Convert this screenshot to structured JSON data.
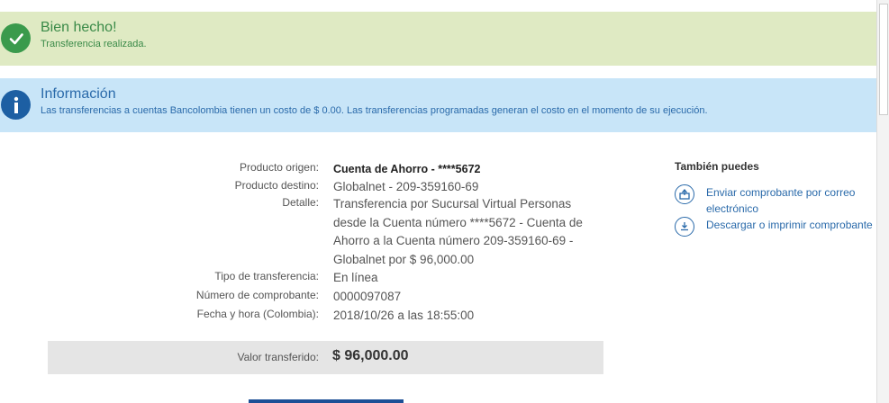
{
  "success_alert": {
    "title": "Bien hecho!",
    "message": "Transferencia realizada."
  },
  "info_alert": {
    "title": "Información",
    "message": "Las transferencias a cuentas Bancolombia tienen un costo de $ 0.00. Las transferencias programadas generan el costo en el momento de su ejecución."
  },
  "details": {
    "origen_label": "Producto origen:",
    "origen_value": "Cuenta de Ahorro - ****5672",
    "destino_label": "Producto destino:",
    "destino_value": "Globalnet - 209-359160-69",
    "detalle_label": "Detalle:",
    "detalle_value": "Transferencia por Sucursal Virtual Personas desde la Cuenta número ****5672 - Cuenta de Ahorro a la Cuenta número 209-359160-69 - Globalnet por $ 96,000.00",
    "tipo_label": "Tipo de transferencia:",
    "tipo_value": "En línea",
    "comprobante_label": "Número de comprobante:",
    "comprobante_value": "0000097087",
    "fecha_label": "Fecha y hora (Colombia):",
    "fecha_value": "2018/10/26 a las 18:55:00"
  },
  "transfer": {
    "label": "Valor transferido:",
    "value": "$ 96,000.00"
  },
  "side": {
    "title": "También puedes",
    "email_link": "Enviar comprobante por correo electrónico",
    "download_link": "Descargar o imprimir comprobante"
  },
  "colors": {
    "success_bg": "#dfeac3",
    "info_bg": "#c8e5f8",
    "brand_blue": "#2a6aaa"
  }
}
